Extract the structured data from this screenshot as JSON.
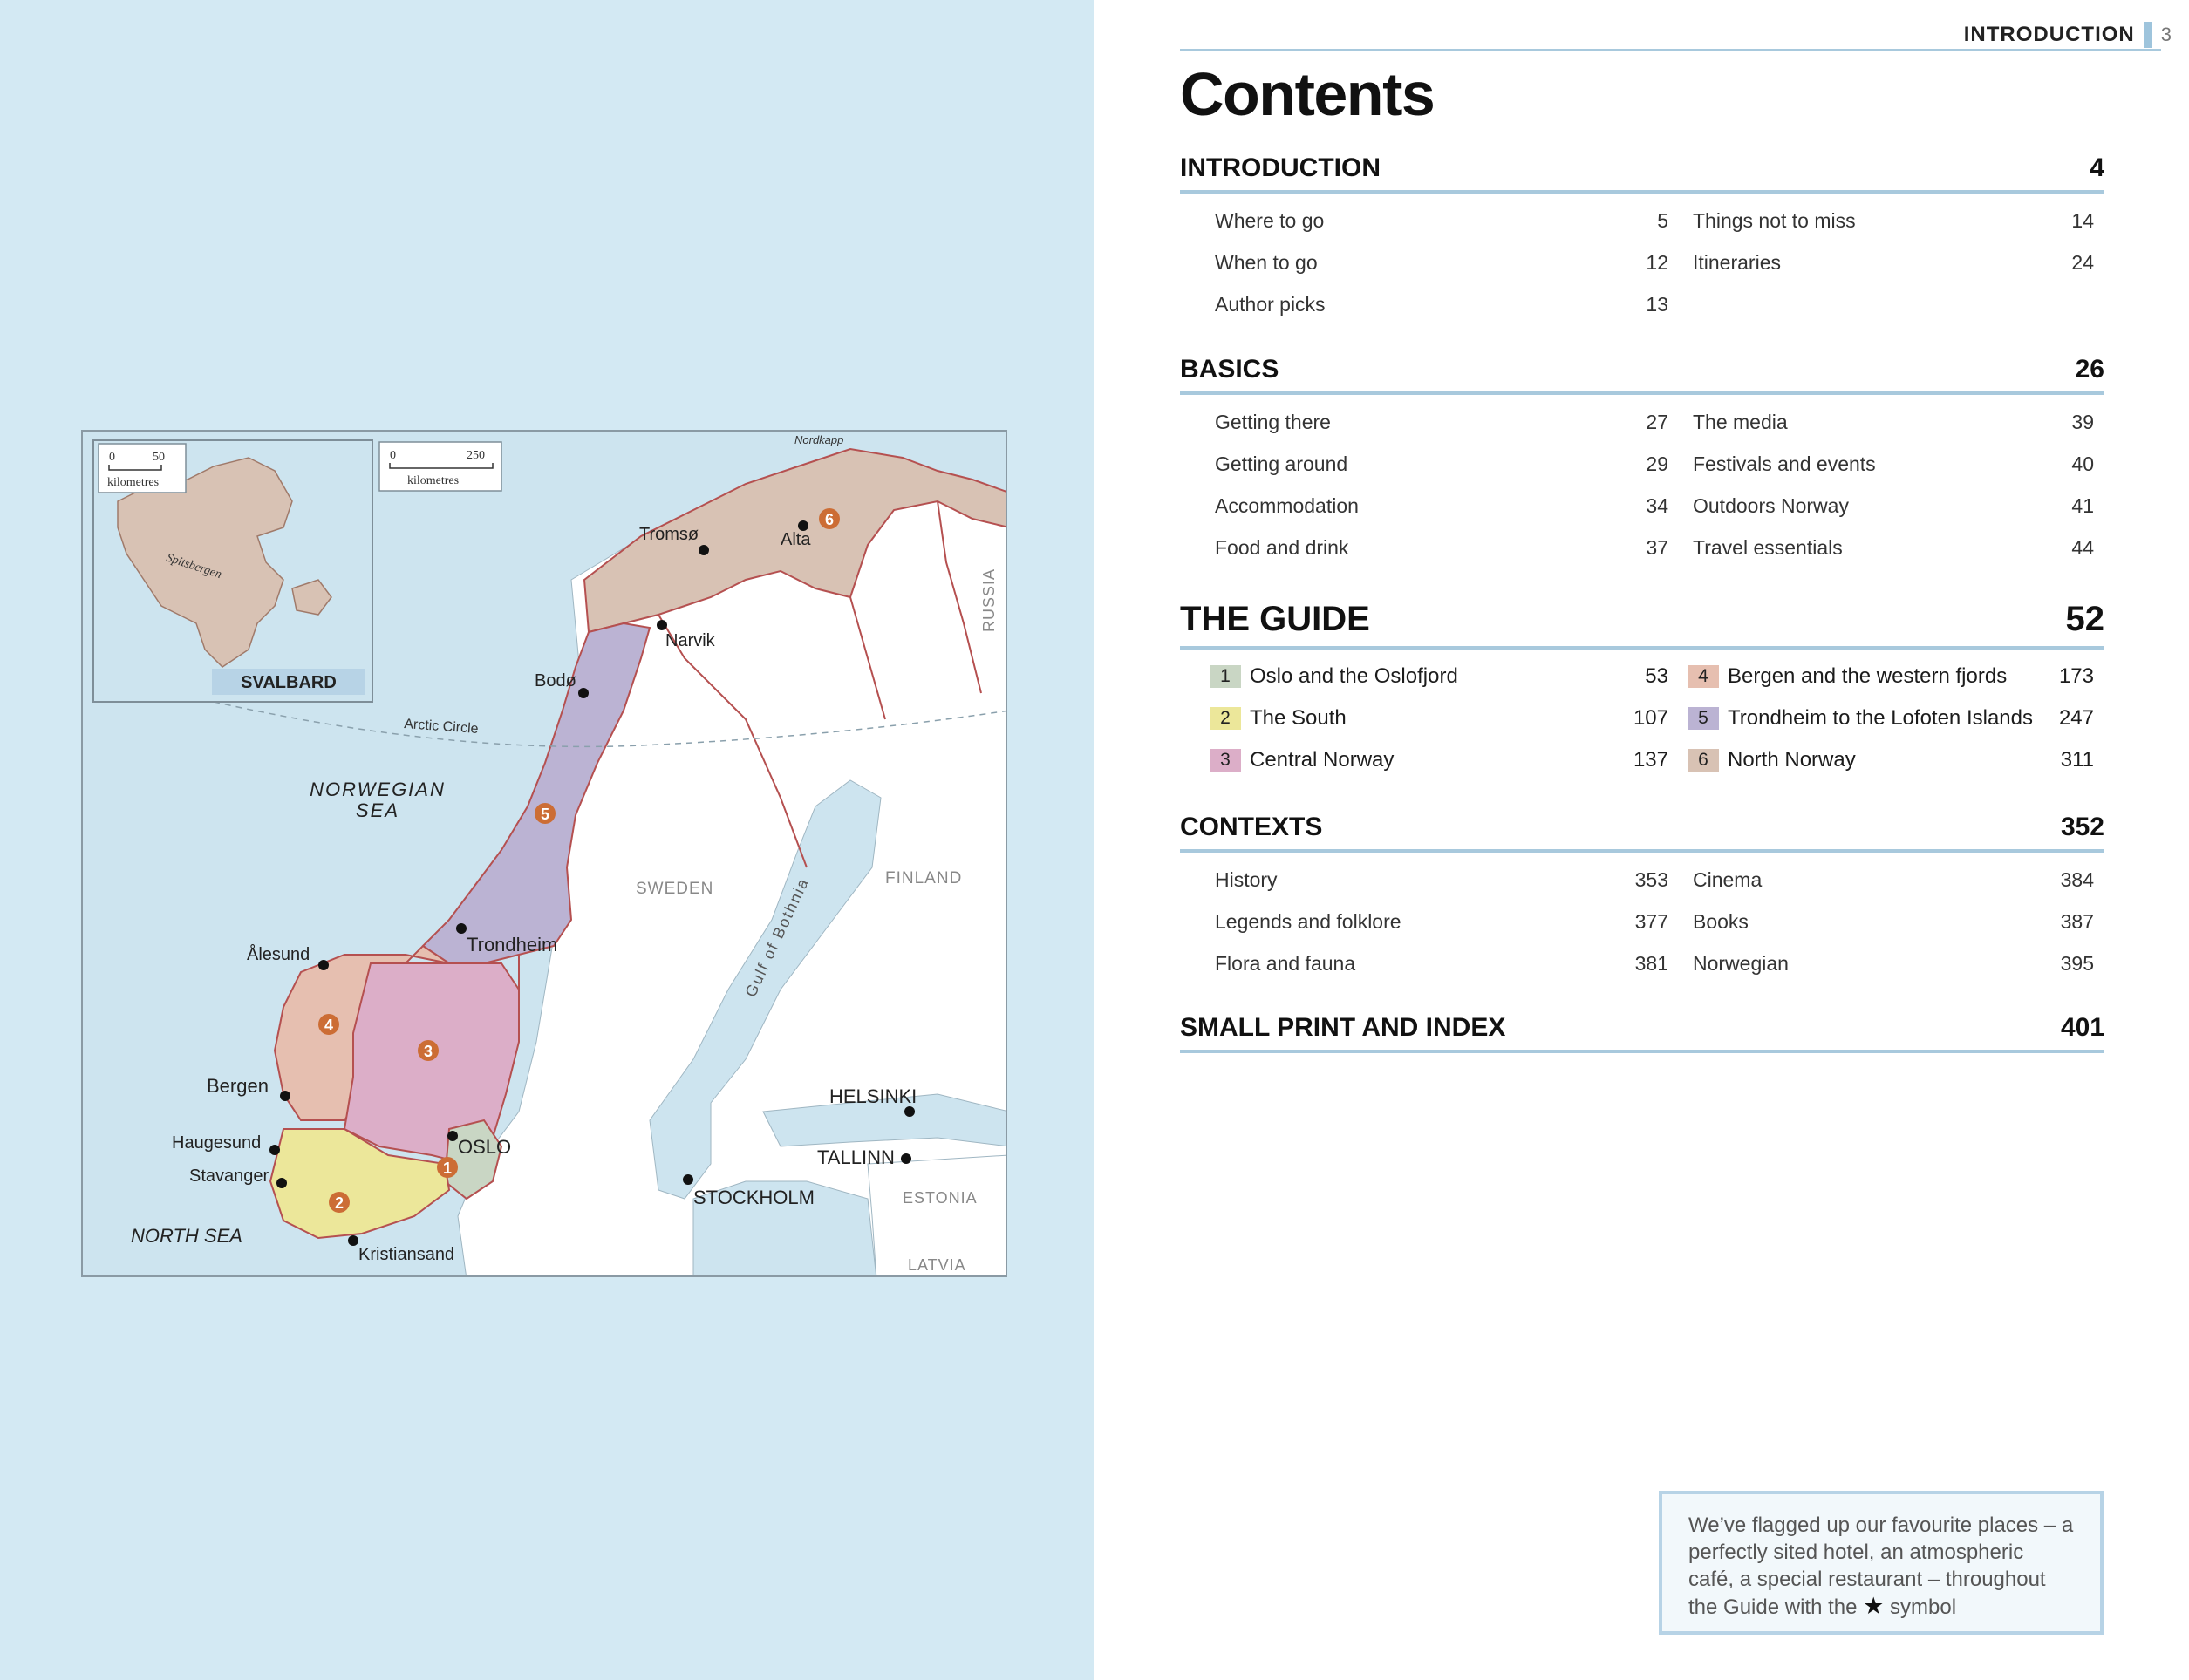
{
  "running_head": {
    "section": "INTRODUCTION",
    "page_number": "3"
  },
  "title": "Contents",
  "colors": {
    "page_background": "#d3e9f3",
    "rule": "#a8c9dd",
    "region_1": "#c9d6c4",
    "region_2": "#ece79a",
    "region_3": "#dcaec8",
    "region_4": "#e6bfb0",
    "region_5": "#bbb3d3",
    "region_6": "#d8c2b4",
    "marker": "#cc6d35"
  },
  "sections": {
    "introduction": {
      "heading": "INTRODUCTION",
      "page": "4",
      "left": [
        {
          "label": "Where to go",
          "page": "5"
        },
        {
          "label": "When to go",
          "page": "12"
        },
        {
          "label": "Author picks",
          "page": "13"
        }
      ],
      "right": [
        {
          "label": "Things not to miss",
          "page": "14"
        },
        {
          "label": "Itineraries",
          "page": "24"
        }
      ]
    },
    "basics": {
      "heading": "BASICS",
      "page": "26",
      "left": [
        {
          "label": "Getting there",
          "page": "27"
        },
        {
          "label": "Getting around",
          "page": "29"
        },
        {
          "label": "Accommodation",
          "page": "34"
        },
        {
          "label": "Food and drink",
          "page": "37"
        }
      ],
      "right": [
        {
          "label": "The media",
          "page": "39"
        },
        {
          "label": "Festivals and events",
          "page": "40"
        },
        {
          "label": "Outdoors Norway",
          "page": "41"
        },
        {
          "label": "Travel essentials",
          "page": "44"
        }
      ]
    },
    "guide": {
      "heading": "THE GUIDE",
      "page": "52",
      "left": [
        {
          "num": "1",
          "label": "Oslo and the Oslofjord",
          "page": "53"
        },
        {
          "num": "2",
          "label": "The South",
          "page": "107"
        },
        {
          "num": "3",
          "label": "Central Norway",
          "page": "137"
        }
      ],
      "right": [
        {
          "num": "4",
          "label": "Bergen and the western fjords",
          "page": "173"
        },
        {
          "num": "5",
          "label": "Trondheim to the Lofoten Islands",
          "page": "247"
        },
        {
          "num": "6",
          "label": "North Norway",
          "page": "311"
        }
      ]
    },
    "contexts": {
      "heading": "CONTEXTS",
      "page": "352",
      "left": [
        {
          "label": "History",
          "page": "353"
        },
        {
          "label": "Legends and folklore",
          "page": "377"
        },
        {
          "label": "Flora and fauna",
          "page": "381"
        }
      ],
      "right": [
        {
          "label": "Cinema",
          "page": "384"
        },
        {
          "label": "Books",
          "page": "387"
        },
        {
          "label": "Norwegian",
          "page": "395"
        }
      ]
    },
    "small_print": {
      "heading": "SMALL PRINT AND INDEX",
      "page": "401"
    }
  },
  "callout": {
    "text_before": "We’ve flagged up our favourite places – a perfectly sited hotel, an atmospheric café, a special restaurant – throughout the Guide with the",
    "star_icon": "★",
    "text_after": "symbol"
  },
  "map": {
    "scale_inset": {
      "zero": "0",
      "max": "50",
      "unit": "kilometres"
    },
    "scale_main": {
      "zero": "0",
      "max": "250",
      "unit": "kilometres"
    },
    "inset_label": "SVALBARD",
    "inset_island": "Spitsbergen",
    "seas": {
      "norwegian_1": "NORWEGIAN",
      "norwegian_2": "SEA",
      "north": "NORTH SEA"
    },
    "countries": {
      "sweden": "SWEDEN",
      "finland": "FINLAND",
      "russia": "RUSSIA",
      "estonia": "ESTONIA",
      "latvia": "LATVIA"
    },
    "features": {
      "arctic_circle": "Arctic Circle",
      "gulf": "Gulf of Bothnia",
      "nordkapp": "Nordkapp"
    },
    "cities": {
      "tromso": "Tromsø",
      "alta": "Alta",
      "narvik": "Narvik",
      "bodo": "Bodø",
      "trondheim": "Trondheim",
      "alesund": "Ålesund",
      "bergen": "Bergen",
      "haugesund": "Haugesund",
      "stavanger": "Stavanger",
      "kristiansand": "Kristiansand",
      "oslo": "OSLO",
      "stockholm": "STOCKHOLM",
      "helsinki": "HELSINKI",
      "tallinn": "TALLINN"
    },
    "markers": {
      "m1": "1",
      "m2": "2",
      "m3": "3",
      "m4": "4",
      "m5": "5",
      "m6": "6"
    }
  }
}
